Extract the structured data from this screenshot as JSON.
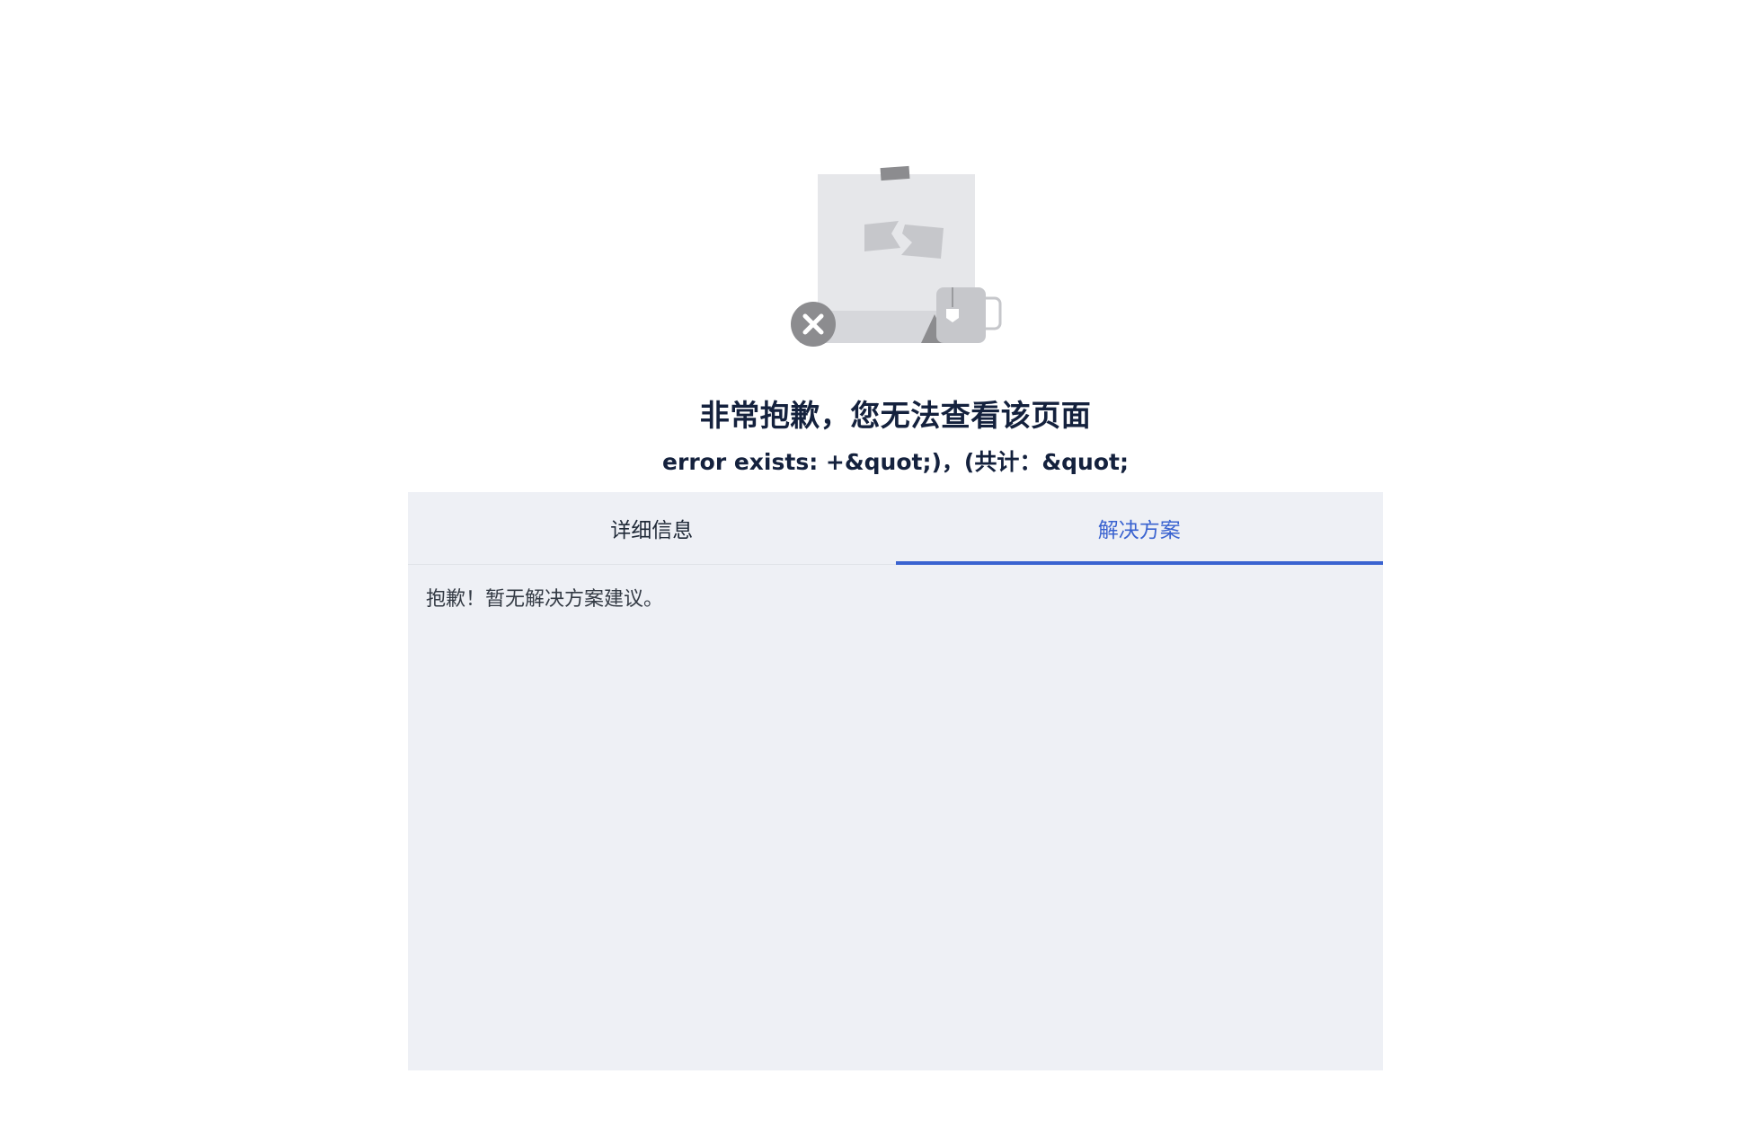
{
  "error": {
    "title": "非常抱歉，您无法查看该页面",
    "message": "error exists: +&quot;)，(共计：&quot;"
  },
  "tabs": [
    {
      "label": "详细信息",
      "active": false
    },
    {
      "label": "解决方案",
      "active": true
    }
  ],
  "panel": {
    "content": "抱歉！暂无解决方案建议。"
  },
  "colors": {
    "accent": "#3a63d0",
    "title_text": "#14213d",
    "panel_bg": "#eef0f5"
  },
  "icons": {
    "illustration": "broken-page-illustration",
    "error": "close-circle-icon"
  }
}
